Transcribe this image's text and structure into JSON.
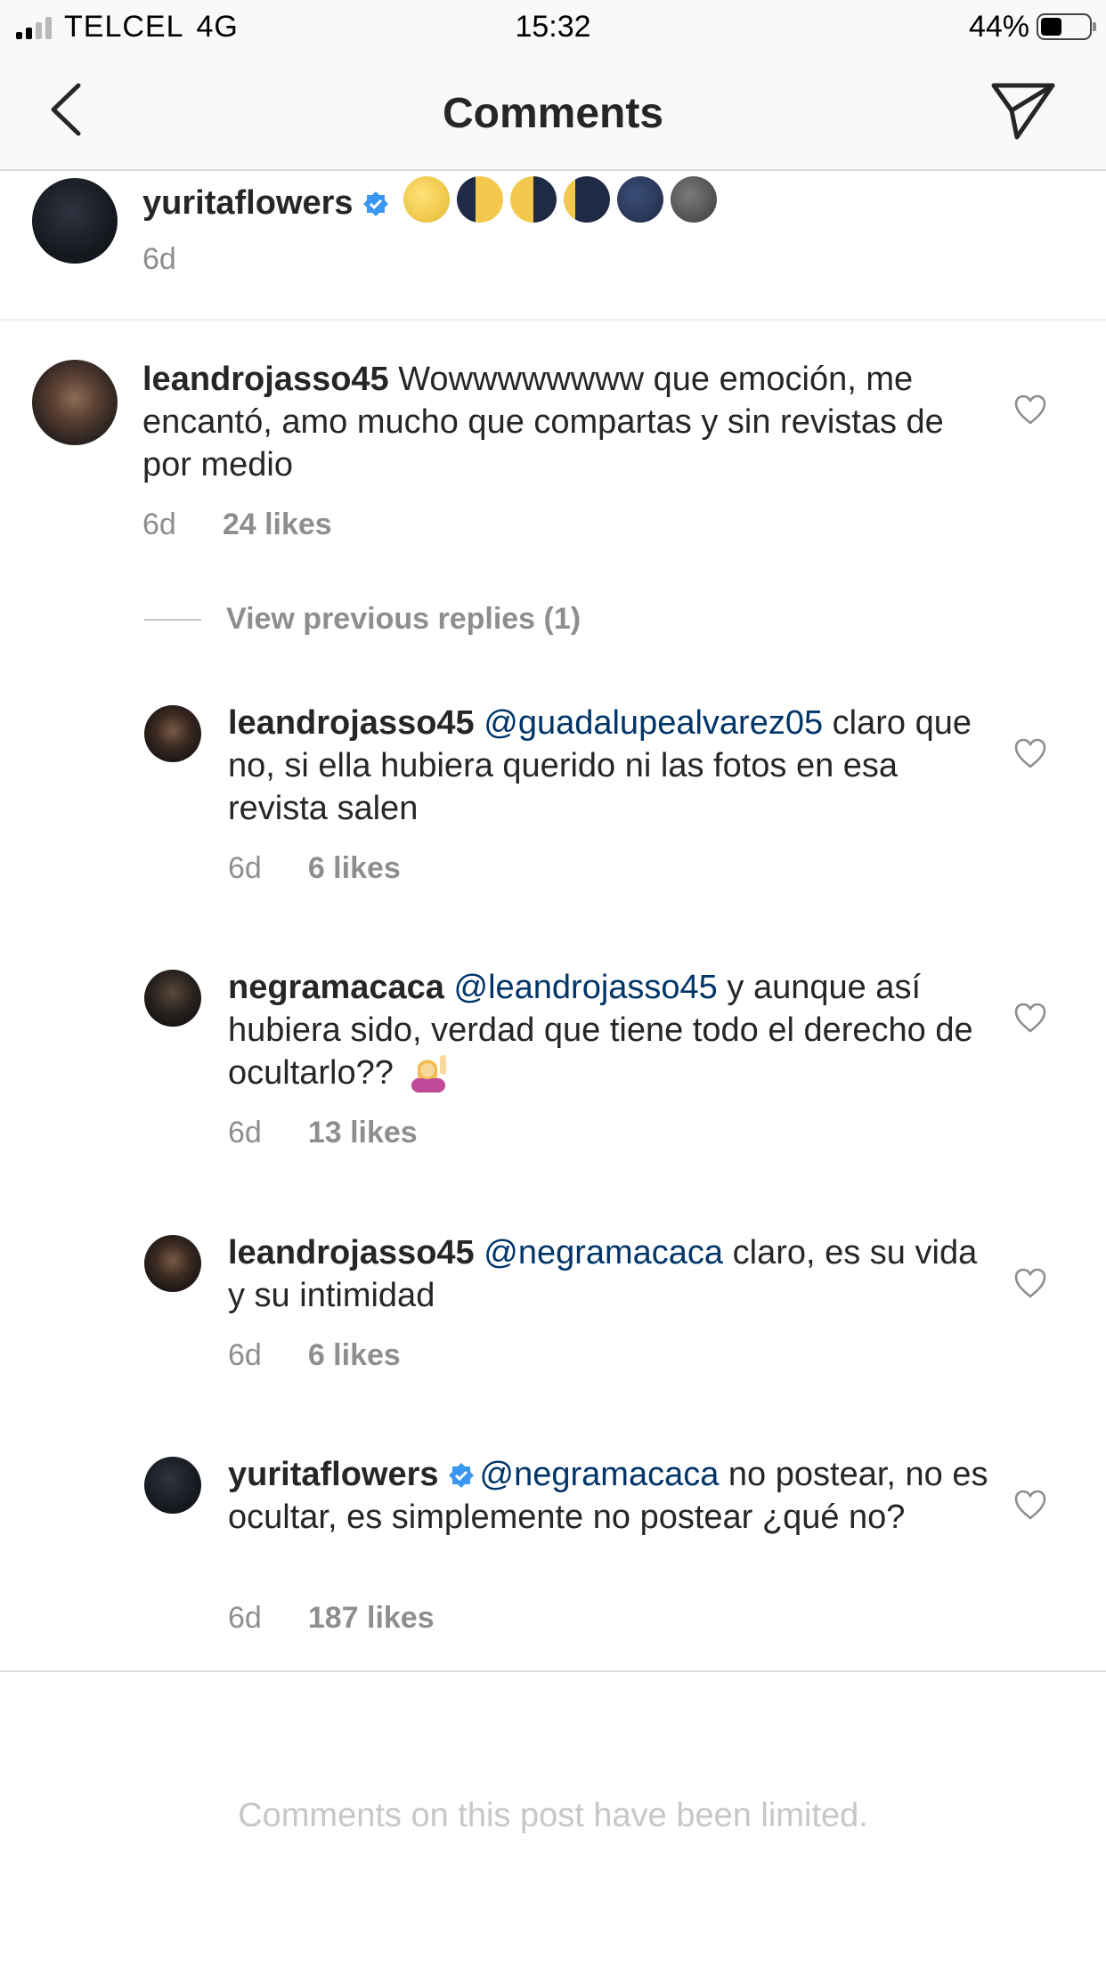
{
  "status_bar": {
    "carrier": "TELCEL",
    "network": "4G",
    "time": "15:32",
    "battery": "44%",
    "battery_level": 0.44
  },
  "header": {
    "title": "Comments",
    "back_icon": "chevron-left-icon",
    "share_icon": "paper-plane-icon"
  },
  "caption": {
    "username": "yuritaflowers",
    "verified": true,
    "moon_emojis": [
      "full-moon",
      "waning-gibbous",
      "last-quarter",
      "waning-crescent",
      "new-moon",
      "new-moon-face"
    ],
    "time": "6d"
  },
  "comments": [
    {
      "username": "leandrojasso45",
      "text": "Wowwwwwwww que emoción, me encantó, amo mucho que compartas y sin revistas de por medio",
      "time": "6d",
      "likes": "24 likes"
    }
  ],
  "view_previous_replies": "View previous replies (1)",
  "replies": [
    {
      "username": "leandrojasso45",
      "mention": "@guadalupealvarez05",
      "text": "claro que no, si ella hubiera querido ni las fotos en esa revista salen",
      "time": "6d",
      "likes": "6 likes"
    },
    {
      "username": "negramacaca",
      "mention": "@leandrojasso45",
      "text": "y aunque así hubiera sido, verdad que tiene todo el derecho de ocultarlo??",
      "emoji": "person-raising-hand",
      "time": "6d",
      "likes": "13 likes"
    },
    {
      "username": "leandrojasso45",
      "mention": "@negramacaca",
      "text": "claro, es su vida y su intimidad",
      "time": "6d",
      "likes": "6 likes"
    },
    {
      "username": "yuritaflowers",
      "verified": true,
      "mention": "@negramacaca",
      "text": " no postear, no es ocultar, es simplemente no postear ¿qué no?",
      "time": "6d",
      "likes": "187 likes"
    }
  ],
  "footer": {
    "limited_text": "Comments on this post have been limited."
  },
  "colors": {
    "text": "#262626",
    "secondary": "#8e8e8e",
    "mention": "#003569",
    "verified": "#3897f0",
    "bar_bg": "#f9f9f9"
  }
}
